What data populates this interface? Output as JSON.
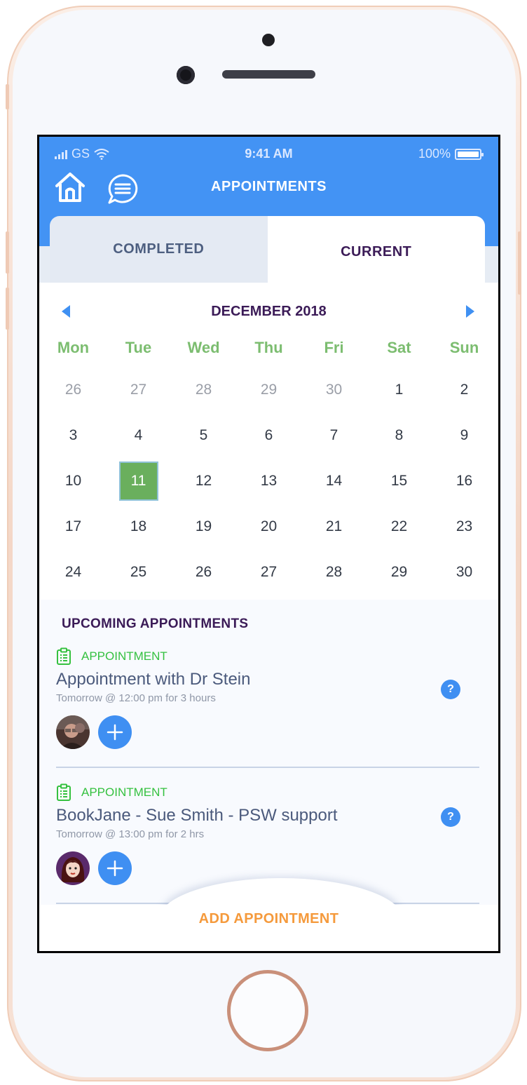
{
  "status_bar": {
    "carrier": "GS",
    "time": "9:41 AM",
    "battery": "100%"
  },
  "header": {
    "title": "APPOINTMENTS"
  },
  "tabs": [
    {
      "label": "COMPLETED"
    },
    {
      "label": "CURRENT"
    }
  ],
  "calendar": {
    "month": "DECEMBER 2018",
    "weekdays": [
      "Mon",
      "Tue",
      "Wed",
      "Thu",
      "Fri",
      "Sat",
      "Sun"
    ],
    "weeks": [
      [
        "26",
        "27",
        "28",
        "29",
        "30",
        "1",
        "2"
      ],
      [
        "3",
        "4",
        "5",
        "6",
        "7",
        "8",
        "9"
      ],
      [
        "10",
        "11",
        "12",
        "13",
        "14",
        "15",
        "16"
      ],
      [
        "17",
        "18",
        "19",
        "20",
        "21",
        "22",
        "23"
      ],
      [
        "24",
        "25",
        "26",
        "27",
        "28",
        "29",
        "30"
      ]
    ],
    "selected_day": "11"
  },
  "upcoming": {
    "title": "UPCOMING APPOINTMENTS",
    "items": [
      {
        "type": "APPOINTMENT",
        "name": "Appointment with Dr Stein",
        "when": "Tomorrow @ 12:00 pm for 3 hours",
        "help": "?"
      },
      {
        "type": "APPOINTMENT",
        "name": "BookJane - Sue Smith - PSW support",
        "when": "Tomorrow @ 13:00 pm for 2 hrs",
        "help": "?"
      }
    ]
  },
  "footer": {
    "add_label": "ADD APPOINTMENT"
  },
  "colors": {
    "primary": "#4393f4",
    "accent_green": "#6aaf5d",
    "accent_orange": "#f59a3c",
    "heading_purple": "#3b1b57"
  }
}
